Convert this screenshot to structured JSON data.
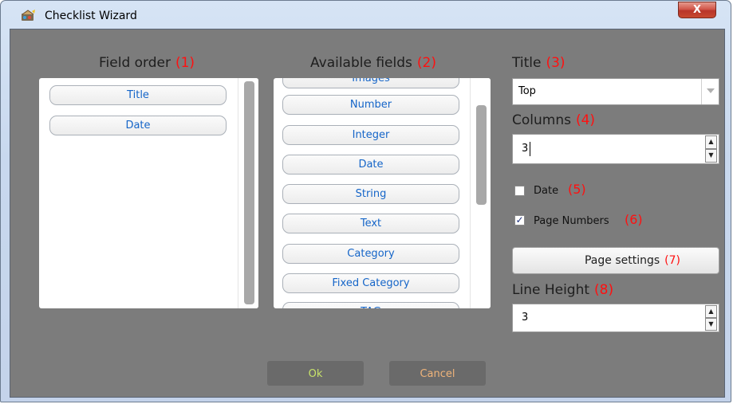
{
  "window": {
    "title": "Checklist Wizard",
    "close_label": "X"
  },
  "field_order": {
    "heading": "Field order",
    "number": "(1)",
    "items": [
      "Title",
      "Date"
    ]
  },
  "available_fields": {
    "heading": "Available fields",
    "number": "(2)",
    "items": [
      "Images",
      "Number",
      "Integer",
      "Date",
      "String",
      "Text",
      "Category",
      "Fixed Category",
      "TAG"
    ]
  },
  "title_option": {
    "label": "Title",
    "number": "(3)",
    "value": "Top"
  },
  "columns_option": {
    "label": "Columns",
    "number": "(4)",
    "value": "3"
  },
  "date_option": {
    "label": "Date",
    "number": "(5)",
    "checked": false
  },
  "page_numbers_option": {
    "label": "Page Numbers",
    "number": "(6)",
    "checked": true,
    "check_mark": "✓"
  },
  "page_settings": {
    "label": "Page settings",
    "number": "(7)"
  },
  "line_height_option": {
    "label": "Line Height",
    "number": "(8)",
    "value": "3"
  },
  "spin": {
    "up": "▲",
    "down": "▼"
  },
  "buttons": {
    "ok": "Ok",
    "cancel": "Cancel"
  },
  "colors": {
    "accent_number": "#ff1010",
    "pill_text": "#1565c8",
    "client_bg": "#7c7c7c",
    "close_button": "#c7482f"
  }
}
